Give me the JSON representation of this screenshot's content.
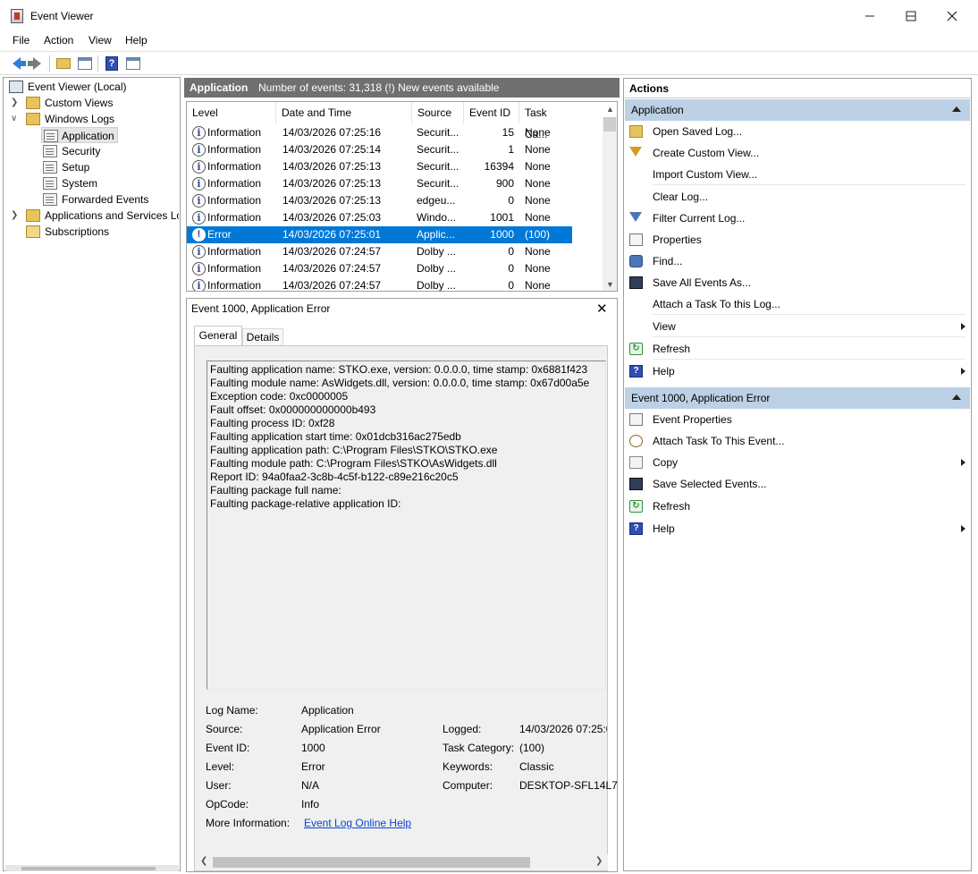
{
  "window": {
    "title": "Event Viewer"
  },
  "menu": [
    "File",
    "Action",
    "View",
    "Help"
  ],
  "tree": {
    "root": "Event Viewer (Local)",
    "custom_views": "Custom Views",
    "windows_logs": "Windows Logs",
    "logs": [
      "Application",
      "Security",
      "Setup",
      "System",
      "Forwarded Events"
    ],
    "apps_services": "Applications and Services Lo",
    "subscriptions": "Subscriptions"
  },
  "center": {
    "title": "Application",
    "count": "Number of events: 31,318 (!) New events available",
    "columns": [
      "Level",
      "Date and Time",
      "Source",
      "Event ID",
      "Task Ca..."
    ],
    "rows": [
      {
        "level": "Information",
        "date": "14/03/2026 07:25:16",
        "source": "Securit...",
        "id": "15",
        "task": "None"
      },
      {
        "level": "Information",
        "date": "14/03/2026 07:25:14",
        "source": "Securit...",
        "id": "1",
        "task": "None"
      },
      {
        "level": "Information",
        "date": "14/03/2026 07:25:13",
        "source": "Securit...",
        "id": "16394",
        "task": "None"
      },
      {
        "level": "Information",
        "date": "14/03/2026 07:25:13",
        "source": "Securit...",
        "id": "900",
        "task": "None"
      },
      {
        "level": "Information",
        "date": "14/03/2026 07:25:13",
        "source": "edgeu...",
        "id": "0",
        "task": "None"
      },
      {
        "level": "Information",
        "date": "14/03/2026 07:25:03",
        "source": "Windo...",
        "id": "1001",
        "task": "None"
      },
      {
        "level": "Error",
        "date": "14/03/2026 07:25:01",
        "source": "Applic...",
        "id": "1000",
        "task": "(100)"
      },
      {
        "level": "Information",
        "date": "14/03/2026 07:24:57",
        "source": "Dolby ...",
        "id": "0",
        "task": "None"
      },
      {
        "level": "Information",
        "date": "14/03/2026 07:24:57",
        "source": "Dolby ...",
        "id": "0",
        "task": "None"
      },
      {
        "level": "Information",
        "date": "14/03/2026 07:24:57",
        "source": "Dolby ...",
        "id": "0",
        "task": "None"
      }
    ]
  },
  "detail": {
    "title": "Event 1000, Application Error",
    "tabs": [
      "General",
      "Details"
    ],
    "description": [
      "Faulting application name: STKO.exe, version: 0.0.0.0, time stamp: 0x6881f423",
      "Faulting module name: AsWidgets.dll, version: 0.0.0.0, time stamp: 0x67d00a5e",
      "Exception code: 0xc0000005",
      "Fault offset: 0x000000000000b493",
      "Faulting process ID: 0xf28",
      "Faulting application start time: 0x01dcb316ac275edb",
      "Faulting application path: C:\\Program Files\\STKO\\STKO.exe",
      "Faulting module path: C:\\Program Files\\STKO\\AsWidgets.dll",
      "Report ID: 94a0faa2-3c8b-4c5f-b122-c89e216c20c5",
      "Faulting package full name:",
      "Faulting package-relative application ID:"
    ],
    "fields": {
      "log_name_label": "Log Name:",
      "log_name": "Application",
      "source_label": "Source:",
      "source": "Application Error",
      "logged_label": "Logged:",
      "logged": "14/03/2026 07:25:0",
      "event_id_label": "Event ID:",
      "event_id": "1000",
      "task_category_label": "Task Category:",
      "task_category": "(100)",
      "level_label": "Level:",
      "level": "Error",
      "keywords_label": "Keywords:",
      "keywords": "Classic",
      "user_label": "User:",
      "user": "N/A",
      "computer_label": "Computer:",
      "computer": "DESKTOP-SFL14L7",
      "opcode_label": "OpCode:",
      "opcode": "Info",
      "more_info_label": "More Information:",
      "more_info_link": "Event Log Online Help"
    }
  },
  "actions": {
    "header": "Actions",
    "section1": "Application",
    "items1": [
      "Open Saved Log...",
      "Create Custom View...",
      "Import Custom View...",
      "Clear Log...",
      "Filter Current Log...",
      "Properties",
      "Find...",
      "Save All Events As...",
      "Attach a Task To this Log...",
      "View",
      "Refresh",
      "Help"
    ],
    "section2": "Event 1000, Application Error",
    "items2": [
      "Event Properties",
      "Attach Task To This Event...",
      "Copy",
      "Save Selected Events...",
      "Refresh",
      "Help"
    ]
  }
}
